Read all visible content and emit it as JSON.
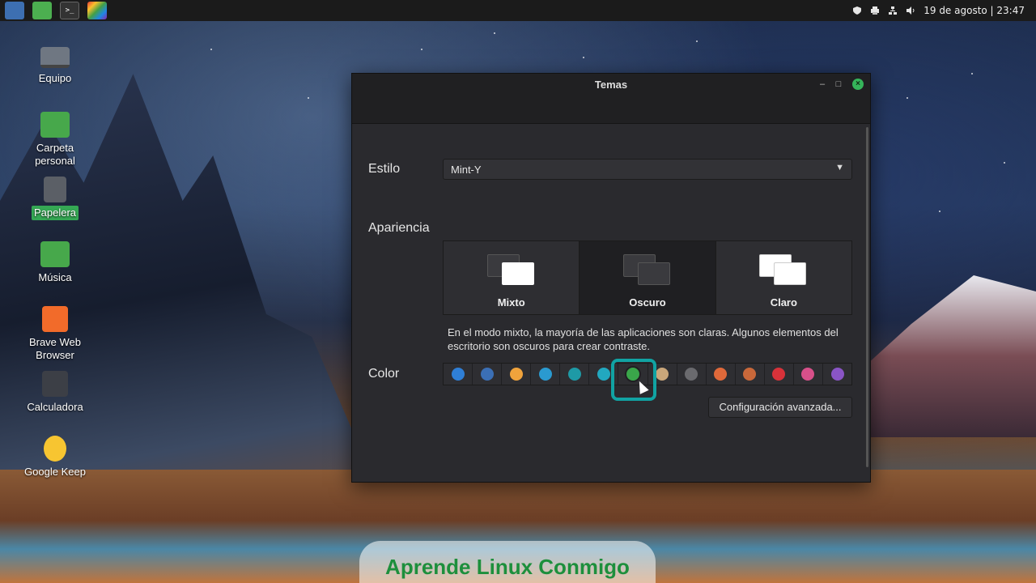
{
  "panel": {
    "clock": "19 de agosto | 23:47"
  },
  "desktop": {
    "icons": [
      {
        "label": "Equipo"
      },
      {
        "label": "Carpeta personal"
      },
      {
        "label": "Papelera"
      },
      {
        "label": "Música"
      },
      {
        "label": "Brave Web Browser"
      },
      {
        "label": "Calculadora"
      },
      {
        "label": "Google Keep"
      }
    ]
  },
  "window": {
    "title": "Temas",
    "style_label": "Estilo",
    "style_value": "Mint-Y",
    "appearance_label": "Apariencia",
    "appearance_options": [
      {
        "label": "Mixto",
        "selected": false
      },
      {
        "label": "Oscuro",
        "selected": true
      },
      {
        "label": "Claro",
        "selected": false
      }
    ],
    "hint": "En el modo mixto, la mayoría de las aplicaciones son claras. Algunos elementos del escritorio son oscuros para crear contraste.",
    "color_label": "Color",
    "colors": [
      "#2f7fd6",
      "#3b6fb5",
      "#f0a33c",
      "#2a9ad0",
      "#1e9aa6",
      "#22a8c0",
      "#3aa64a",
      "#c9a67a",
      "#6a6a6e",
      "#e0693a",
      "#c9683a",
      "#d8323a",
      "#d8508a",
      "#8a55c6"
    ],
    "selected_color_index": 6,
    "advanced_button": "Configuración avanzada..."
  },
  "watermark": "Aprende Linux Conmigo"
}
